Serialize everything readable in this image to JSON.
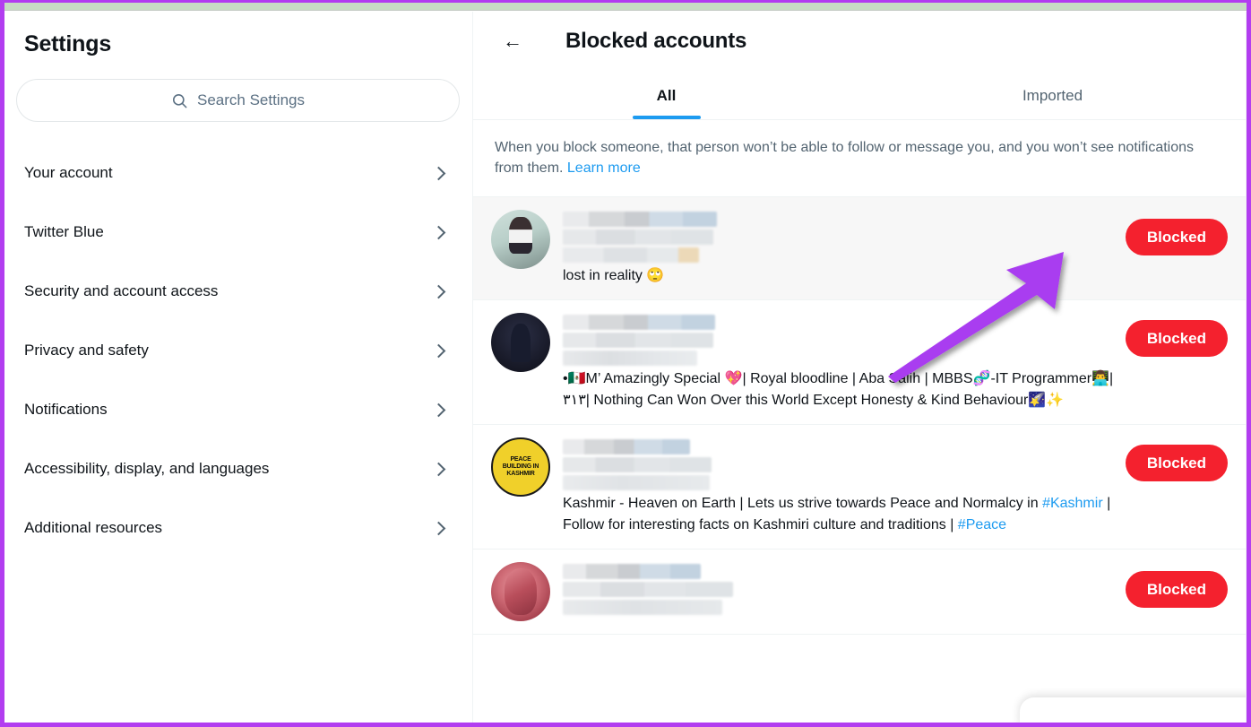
{
  "sidebar": {
    "title": "Settings",
    "search": {
      "placeholder": "Search Settings",
      "icon": "search-icon"
    },
    "items": [
      {
        "label": "Your account",
        "icon": "chevron-right-icon"
      },
      {
        "label": "Twitter Blue",
        "icon": "chevron-right-icon"
      },
      {
        "label": "Security and account access",
        "icon": "chevron-right-icon"
      },
      {
        "label": "Privacy and safety",
        "icon": "chevron-right-icon"
      },
      {
        "label": "Notifications",
        "icon": "chevron-right-icon"
      },
      {
        "label": "Accessibility, display, and languages",
        "icon": "chevron-right-icon"
      },
      {
        "label": "Additional resources",
        "icon": "chevron-right-icon"
      }
    ]
  },
  "main": {
    "back_icon": "←",
    "title": "Blocked accounts",
    "tabs": [
      {
        "label": "All",
        "active": true
      },
      {
        "label": "Imported",
        "active": false
      }
    ],
    "description": "When you block someone, that person won’t be able to follow or message you, and you won’t see notifications from them. ",
    "description_link": "Learn more",
    "accounts": [
      {
        "display_name": "",
        "handle": "",
        "bio": "lost in reality 🙄",
        "button_label": "Blocked",
        "avatar": "av1",
        "hovered": true
      },
      {
        "display_name": "",
        "handle": "",
        "bio_parts": [
          {
            "text": "•🇲🇽M’ Amazingly Special 💖| Royal bloodline | Aba Salih | MBBS🧬-IT Programmer👨‍💻|٣١٣| Nothing Can Won Over this World Except Honesty & Kind Behaviour🌠✨",
            "link": false
          }
        ],
        "button_label": "Blocked",
        "avatar": "av2",
        "hovered": false
      },
      {
        "display_name": "",
        "handle": "",
        "bio_parts": [
          {
            "text": "Kashmir - Heaven on Earth | Lets us strive towards Peace and Normalcy in ",
            "link": false
          },
          {
            "text": "#Kashmir",
            "link": true
          },
          {
            "text": " | Follow for interesting facts on Kashmiri culture and traditions | ",
            "link": false
          },
          {
            "text": "#Peace",
            "link": true
          }
        ],
        "button_label": "Blocked",
        "avatar": "av3",
        "avatar_text": "PEACE BUILDING IN KASHMIR",
        "hovered": false
      },
      {
        "display_name": "",
        "handle": "",
        "bio_parts": [],
        "button_label": "Blocked",
        "avatar": "av4",
        "hovered": false
      }
    ]
  },
  "annotation": {
    "type": "arrow",
    "color": "#a93df0",
    "points_to": "Blocked button of first account"
  },
  "colors": {
    "accent_blue": "#1d9bf0",
    "blocked_red": "#f4212e",
    "text_primary": "#0f1419",
    "text_secondary": "#536471",
    "border": "#eff3f4",
    "frame_purple": "#b23df0",
    "top_strip": "#c7ddc4",
    "row_hover": "#f7f7f7"
  }
}
